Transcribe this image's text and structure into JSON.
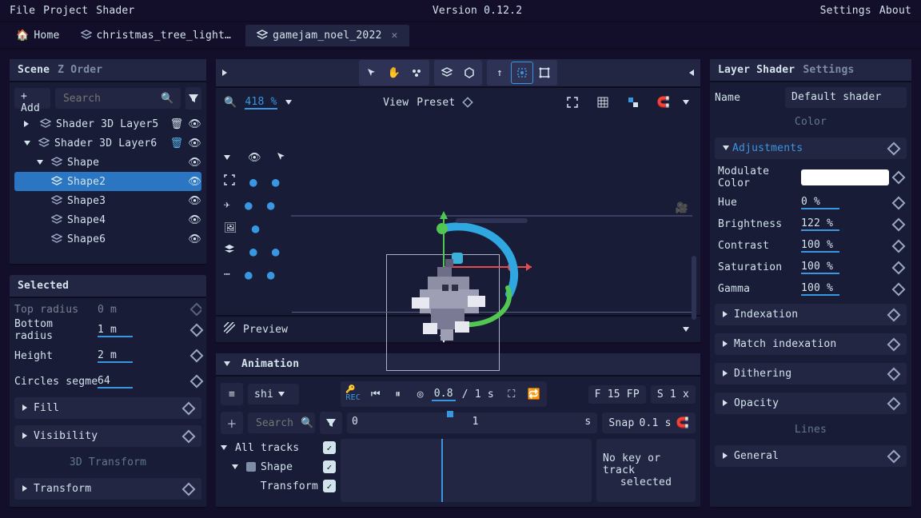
{
  "menu": {
    "file": "File",
    "project": "Project",
    "shader": "Shader"
  },
  "version": "Version 0.12.2",
  "topright": {
    "settings": "Settings",
    "about": "About"
  },
  "tabs": {
    "home": "Home",
    "t1": "christmas_tree_light…",
    "t2": "gamejam_noel_2022"
  },
  "scene": {
    "title": "Scene",
    "tab2": "Z Order",
    "add": "+ Add",
    "search_ph": "Search",
    "items": [
      {
        "label": "Shader 3D Layer5"
      },
      {
        "label": "Shader 3D Layer6"
      },
      {
        "label": "Shape"
      },
      {
        "label": "Shape2"
      },
      {
        "label": "Shape3"
      },
      {
        "label": "Shape4"
      },
      {
        "label": "Shape6"
      }
    ]
  },
  "selected": {
    "title": "Selected",
    "topradius_l": "Top radius",
    "topradius_v": "0 m",
    "bottom_l": "Bottom radius",
    "bottom_v": "1 m",
    "height_l": "Height",
    "height_v": "2 m",
    "circles_l": "Circles segments",
    "circles_v": "64",
    "fill": "Fill",
    "visibility": "Visibility",
    "tdt": "3D Transform",
    "transform": "Transform"
  },
  "viewport": {
    "zoom": "418 %",
    "view": "View",
    "preset": "Preset",
    "preview": "Preview"
  },
  "anim": {
    "title": "Animation",
    "clip": "shi",
    "t": "0.8",
    "len": "/ 1 s",
    "fps": "F 15 FP",
    "sx": "S 1 x",
    "search_ph": "Search",
    "tl_start": "0",
    "tl_end": "1",
    "tl_unit": "s",
    "snap": "Snap",
    "snap_v": "0.1 s",
    "all": "All tracks",
    "shape": "Shape",
    "transform": "Transform",
    "nokey1": "No key or track",
    "nokey2": "selected"
  },
  "layer": {
    "title": "Layer Shader",
    "tab2": "Settings",
    "name_l": "Name",
    "name_v": "Default shader",
    "color_h": "Color",
    "adj": "Adjustments",
    "mod": "Modulate Color",
    "mod_v": "#FFFFFF",
    "hue": "Hue",
    "hue_v": "0 %",
    "bri": "Brightness",
    "bri_v": "122 %",
    "con": "Contrast",
    "con_v": "100 %",
    "sat": "Saturation",
    "sat_v": "100 %",
    "gam": "Gamma",
    "gam_v": "100 %",
    "idx": "Indexation",
    "midx": "Match indexation",
    "dith": "Dithering",
    "opa": "Opacity",
    "lines": "Lines",
    "gen": "General"
  }
}
